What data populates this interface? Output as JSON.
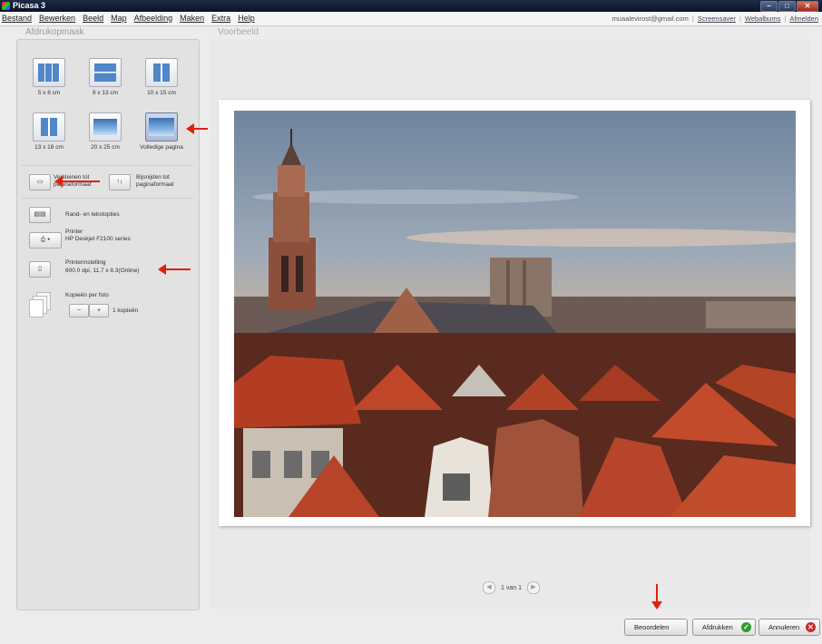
{
  "window": {
    "title": "Picasa 3",
    "min": "–",
    "max": "□",
    "close": "✕"
  },
  "menu": [
    "Bestand",
    "Bewerken",
    "Beeld",
    "Map",
    "Afbeelding",
    "Maken",
    "Extra",
    "Help"
  ],
  "toplinks": {
    "email": "muaalevirost@gmail.com",
    "links": [
      "Screensaver",
      "Webalbums",
      "Afmelden"
    ]
  },
  "panel": {
    "title": "Afdrukopmaak",
    "sizes": [
      "5 x 8 cm",
      "9 x 13 cm",
      "10 x 15 cm",
      "13 x 18 cm",
      "20 x 25 cm",
      "Volledige pagina"
    ],
    "fit_label": "Verkleinen tot paginaformaat",
    "crop_label": "Bijsnijden tot paginaformaat",
    "border_label": "Rand- en tekstopties",
    "printer_label": "Printer",
    "printer_name": "HP Deskjet F2100 series",
    "printer_settings_label": "Printerinstelling",
    "printer_settings_value": "600.0 dpi, 11.7 x 8.3(Online)",
    "copies_label": "Kopieën per foto",
    "copies_value": "1 kopieën",
    "minus": "−",
    "plus": "+"
  },
  "preview": {
    "title": "Voorbeeld",
    "page_indicator": "1 van 1"
  },
  "buttons": {
    "review": "Beoordelen",
    "print": "Afdrukken",
    "cancel": "Annuleren"
  },
  "colors": {
    "accent_arrow": "#e0200e",
    "ok_green": "#2e9b2e",
    "cancel_red": "#c92a2a"
  }
}
